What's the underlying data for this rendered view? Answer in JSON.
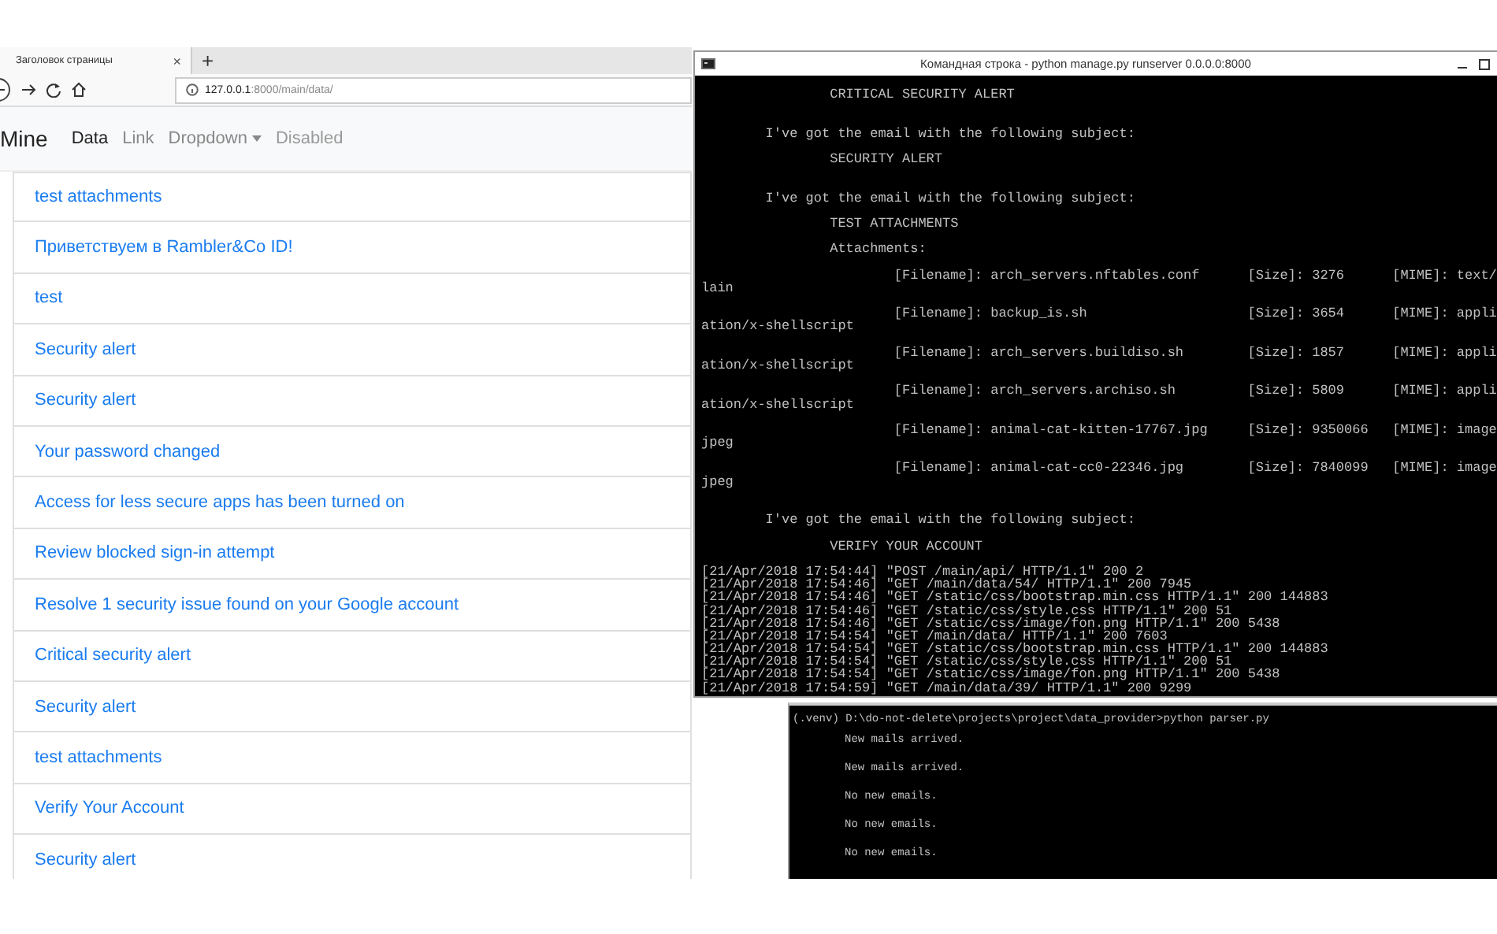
{
  "browser": {
    "tab": {
      "title": "Заголовок страницы",
      "close": "×"
    },
    "new_tab": "+",
    "address": {
      "host": "127.0.0.1",
      "path": ":8000/main/data/"
    },
    "navbar": {
      "brand": "Mine",
      "items": [
        {
          "label": "Data",
          "selected": true,
          "disabled": false,
          "kind": "link"
        },
        {
          "label": "Link",
          "selected": false,
          "disabled": false,
          "kind": "link"
        },
        {
          "label": "Dropdown",
          "selected": false,
          "disabled": false,
          "kind": "dropdown"
        },
        {
          "label": "Disabled",
          "selected": false,
          "disabled": true,
          "kind": "link"
        }
      ]
    },
    "mail_list": [
      "test attachments",
      "Приветствуем в Rambler&Co ID!",
      "test",
      "Security alert",
      "Security alert",
      "Your password changed",
      "Access for less secure apps has been turned on",
      "Review blocked sign-in attempt",
      "Resolve 1 security issue found on your Google account",
      "Critical security alert",
      "Security alert",
      "test attachments",
      "Verify Your Account",
      "Security alert"
    ]
  },
  "server_console": {
    "title": "Командная строка - python  manage.py runserver 0.0.0.0:8000",
    "lines": [
      {
        "kind": "heading",
        "text": "CRITICAL SECURITY ALERT"
      },
      {
        "kind": "blank"
      },
      {
        "kind": "blank"
      },
      {
        "kind": "notice",
        "text": "I've got the email with the following subject:"
      },
      {
        "kind": "blank"
      },
      {
        "kind": "heading",
        "text": "SECURITY ALERT"
      },
      {
        "kind": "blank"
      },
      {
        "kind": "blank"
      },
      {
        "kind": "notice",
        "text": "I've got the email with the following subject:"
      },
      {
        "kind": "blank"
      },
      {
        "kind": "heading",
        "text": "TEST ATTACHMENTS"
      },
      {
        "kind": "blank"
      },
      {
        "kind": "heading",
        "text": "Attachments:"
      },
      {
        "kind": "blank"
      },
      {
        "kind": "attachment",
        "filename": "[Filename]: arch_servers.nftables.conf",
        "size": "[Size]: 3276",
        "mime": "[MIME]: text/"
      },
      {
        "kind": "wrap",
        "text": "lain"
      },
      {
        "kind": "blank"
      },
      {
        "kind": "attachment",
        "filename": "[Filename]: backup_is.sh",
        "size": "[Size]: 3654",
        "mime": "[MIME]: appli"
      },
      {
        "kind": "wrap",
        "text": "ation/x-shellscript"
      },
      {
        "kind": "blank"
      },
      {
        "kind": "attachment",
        "filename": "[Filename]: arch_servers.buildiso.sh",
        "size": "[Size]: 1857",
        "mime": "[MIME]: appli"
      },
      {
        "kind": "wrap",
        "text": "ation/x-shellscript"
      },
      {
        "kind": "blank"
      },
      {
        "kind": "attachment",
        "filename": "[Filename]: arch_servers.archiso.sh",
        "size": "[Size]: 5809",
        "mime": "[MIME]: appli"
      },
      {
        "kind": "wrap",
        "text": "ation/x-shellscript"
      },
      {
        "kind": "blank"
      },
      {
        "kind": "attachment",
        "filename": "[Filename]: animal-cat-kitten-17767.jpg",
        "size": "[Size]: 9350066",
        "mime": "[MIME]: image"
      },
      {
        "kind": "wrap",
        "text": "jpeg"
      },
      {
        "kind": "blank"
      },
      {
        "kind": "attachment",
        "filename": "[Filename]: animal-cat-cc0-22346.jpg",
        "size": "[Size]: 7840099",
        "mime": "[MIME]: image"
      },
      {
        "kind": "wrap",
        "text": "jpeg"
      },
      {
        "kind": "blank"
      },
      {
        "kind": "blank"
      },
      {
        "kind": "notice",
        "text": "I've got the email with the following subject:"
      },
      {
        "kind": "blank"
      },
      {
        "kind": "heading",
        "text": "VERIFY YOUR ACCOUNT"
      },
      {
        "kind": "blank"
      },
      {
        "kind": "log",
        "text": "[21/Apr/2018 17:54:44] \"POST /main/api/ HTTP/1.1\" 200 2"
      },
      {
        "kind": "log",
        "text": "[21/Apr/2018 17:54:46] \"GET /main/data/54/ HTTP/1.1\" 200 7945"
      },
      {
        "kind": "log",
        "text": "[21/Apr/2018 17:54:46] \"GET /static/css/bootstrap.min.css HTTP/1.1\" 200 144883"
      },
      {
        "kind": "log",
        "text": "[21/Apr/2018 17:54:46] \"GET /static/css/style.css HTTP/1.1\" 200 51"
      },
      {
        "kind": "log",
        "text": "[21/Apr/2018 17:54:46] \"GET /static/css/image/fon.png HTTP/1.1\" 200 5438"
      },
      {
        "kind": "log",
        "text": "[21/Apr/2018 17:54:54] \"GET /main/data/ HTTP/1.1\" 200 7603"
      },
      {
        "kind": "log",
        "text": "[21/Apr/2018 17:54:54] \"GET /static/css/bootstrap.min.css HTTP/1.1\" 200 144883"
      },
      {
        "kind": "log",
        "text": "[21/Apr/2018 17:54:54] \"GET /static/css/style.css HTTP/1.1\" 200 51"
      },
      {
        "kind": "log",
        "text": "[21/Apr/2018 17:54:54] \"GET /static/css/image/fon.png HTTP/1.1\" 200 5438"
      },
      {
        "kind": "log",
        "text": "[21/Apr/2018 17:54:59] \"GET /main/data/39/ HTTP/1.1\" 200 9299"
      }
    ]
  },
  "parser_console": {
    "prompt": "(.venv) D:\\do-not-delete\\projects\\project\\data_provider>python parser.py",
    "lines": [
      "New mails arrived.",
      "New mails arrived.",
      "No new emails.",
      "No new emails.",
      "No new emails."
    ]
  }
}
